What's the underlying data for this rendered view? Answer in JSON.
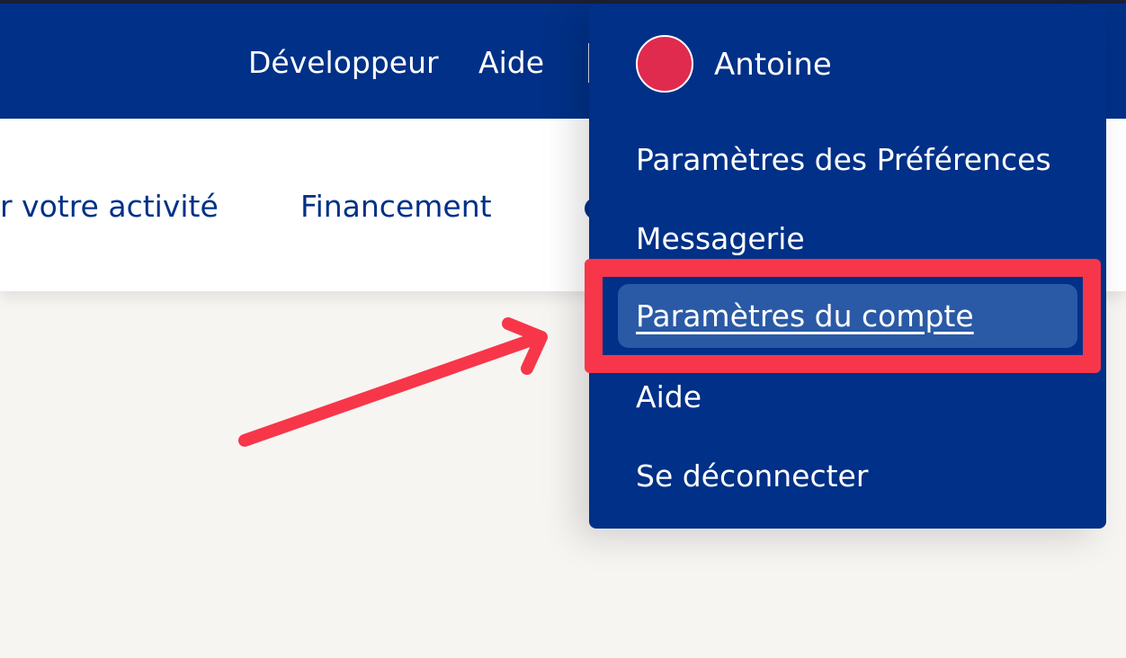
{
  "top_nav": {
    "links": [
      "Développeur",
      "Aide"
    ]
  },
  "sub_nav": {
    "links": [
      "r votre activité",
      "Financement"
    ]
  },
  "account_menu": {
    "user_name": "Antoine",
    "items": [
      "Paramètres des Préférences",
      "Messagerie",
      "Paramètres du compte",
      "Aide",
      "Se déconnecter"
    ],
    "active_item": "Paramètres du compte"
  },
  "annotation": {
    "color": "#f7364a"
  },
  "colors": {
    "brand_navy": "#003087",
    "active_item_bg": "#2a5aa6",
    "avatar": "#e02b4f"
  }
}
